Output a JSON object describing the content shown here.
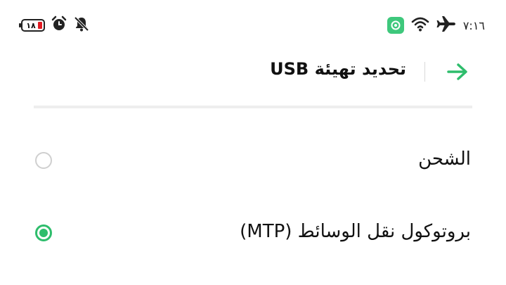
{
  "status_bar": {
    "battery_level": "١٨",
    "time": "٧:١٦",
    "icons": [
      "battery-icon",
      "alarm-icon",
      "notifications-off-icon",
      "app-notification-icon",
      "wifi-icon",
      "airplane-icon"
    ]
  },
  "header": {
    "title": "تحديد تهيئة USB",
    "back_icon": "arrow-right-icon"
  },
  "options": [
    {
      "label": "الشحن",
      "selected": false
    },
    {
      "label": "بروتوكول نقل الوسائط (MTP)",
      "selected": true
    }
  ],
  "colors": {
    "accent": "#2ebd6c",
    "battery_low": "#e21b23",
    "radio_off": "#cfcfcf"
  }
}
